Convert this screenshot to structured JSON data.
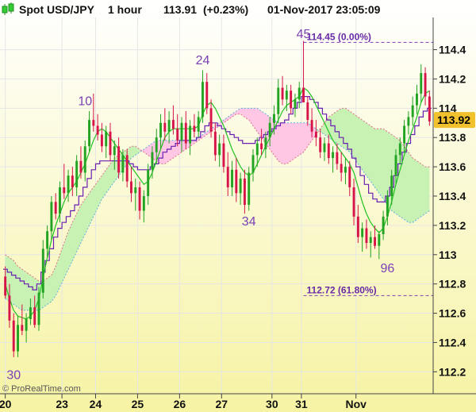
{
  "header": {
    "title": "Spot USD/JPY",
    "timeframe": "1 hour",
    "price": "113.91",
    "change": "(+0.23%)",
    "datetime": "01-Nov-2017 23:05:09"
  },
  "footer": {
    "credit": "© ProRealTime.com"
  },
  "colors": {
    "bull": "#22a322",
    "bear": "#d6144a",
    "kijun": "#6a1fb0",
    "tenkan": "#22c222",
    "cloud_pink": "#ffc7e4",
    "cloud_green": "#c8f2b4",
    "fib": "#7b3fb4",
    "badge": "#f2c12e"
  },
  "chart_data": {
    "type": "candlestick",
    "ylim": [
      112.05,
      114.62
    ],
    "yticks": [
      "114.4",
      "114.2",
      "114",
      "113.8",
      "113.6",
      "113.4",
      "113.2",
      "113",
      "112.8",
      "112.6",
      "112.4",
      "112.2"
    ],
    "xticks": [
      "20",
      "23",
      "24",
      "25",
      "26",
      "27",
      "30",
      "31",
      "Nov"
    ],
    "last_price_badge": "113.92",
    "ohlc": [
      [
        112.85,
        112.92,
        112.7,
        112.72
      ],
      [
        112.72,
        112.8,
        112.5,
        112.55
      ],
      [
        112.55,
        112.6,
        112.3,
        112.34
      ],
      [
        112.34,
        112.58,
        112.3,
        112.52
      ],
      [
        112.52,
        112.66,
        112.45,
        112.48
      ],
      [
        112.48,
        112.6,
        112.4,
        112.56
      ],
      [
        112.56,
        112.7,
        112.52,
        112.64
      ],
      [
        112.64,
        112.72,
        112.5,
        112.52
      ],
      [
        112.52,
        112.78,
        112.48,
        112.74
      ],
      [
        112.74,
        113.1,
        112.7,
        113.04
      ],
      [
        113.04,
        113.2,
        112.98,
        113.16
      ],
      [
        113.16,
        113.4,
        113.1,
        113.36
      ],
      [
        113.36,
        113.42,
        113.24,
        113.28
      ],
      [
        113.28,
        113.5,
        113.22,
        113.46
      ],
      [
        113.46,
        113.62,
        113.38,
        113.42
      ],
      [
        113.42,
        113.58,
        113.36,
        113.54
      ],
      [
        113.54,
        113.6,
        113.4,
        113.46
      ],
      [
        113.46,
        113.68,
        113.4,
        113.64
      ],
      [
        113.64,
        113.74,
        113.52,
        113.56
      ],
      [
        113.56,
        113.78,
        113.5,
        113.74
      ],
      [
        113.74,
        113.98,
        113.7,
        113.92
      ],
      [
        113.92,
        114.1,
        113.84,
        113.88
      ],
      [
        113.88,
        113.96,
        113.78,
        113.82
      ],
      [
        113.82,
        113.9,
        113.7,
        113.74
      ],
      [
        113.74,
        113.88,
        113.66,
        113.84
      ],
      [
        113.84,
        113.9,
        113.64,
        113.68
      ],
      [
        113.68,
        113.78,
        113.58,
        113.74
      ],
      [
        113.74,
        113.8,
        113.52,
        113.56
      ],
      [
        113.56,
        113.72,
        113.5,
        113.68
      ],
      [
        113.68,
        113.72,
        113.46,
        113.5
      ],
      [
        113.5,
        113.6,
        113.36,
        113.42
      ],
      [
        113.42,
        113.52,
        113.3,
        113.46
      ],
      [
        113.46,
        113.5,
        113.24,
        113.3
      ],
      [
        113.3,
        113.44,
        113.22,
        113.4
      ],
      [
        113.4,
        113.62,
        113.34,
        113.58
      ],
      [
        113.58,
        113.74,
        113.52,
        113.7
      ],
      [
        113.7,
        113.86,
        113.62,
        113.8
      ],
      [
        113.8,
        113.96,
        113.72,
        113.9
      ],
      [
        113.9,
        114.0,
        113.78,
        113.84
      ],
      [
        113.84,
        113.98,
        113.76,
        113.92
      ],
      [
        113.92,
        114.02,
        113.82,
        113.86
      ],
      [
        113.86,
        113.96,
        113.74,
        113.78
      ],
      [
        113.78,
        113.94,
        113.7,
        113.9
      ],
      [
        113.9,
        113.98,
        113.72,
        113.76
      ],
      [
        113.76,
        113.92,
        113.68,
        113.88
      ],
      [
        113.88,
        113.96,
        113.8,
        113.84
      ],
      [
        113.84,
        113.98,
        113.8,
        113.94
      ],
      [
        113.94,
        114.26,
        113.9,
        114.18
      ],
      [
        114.18,
        114.24,
        113.96,
        114.0
      ],
      [
        114.0,
        114.06,
        113.8,
        113.84
      ],
      [
        113.84,
        113.9,
        113.64,
        113.68
      ],
      [
        113.68,
        113.82,
        113.6,
        113.76
      ],
      [
        113.76,
        113.82,
        113.56,
        113.6
      ],
      [
        113.6,
        113.7,
        113.4,
        113.46
      ],
      [
        113.46,
        113.64,
        113.4,
        113.58
      ],
      [
        113.58,
        113.66,
        113.36,
        113.42
      ],
      [
        113.42,
        113.56,
        113.34,
        113.52
      ],
      [
        113.52,
        113.58,
        113.28,
        113.34
      ],
      [
        113.34,
        113.6,
        113.3,
        113.56
      ],
      [
        113.56,
        113.72,
        113.5,
        113.68
      ],
      [
        113.68,
        113.8,
        113.6,
        113.76
      ],
      [
        113.76,
        113.86,
        113.68,
        113.72
      ],
      [
        113.72,
        113.84,
        113.66,
        113.8
      ],
      [
        113.8,
        113.94,
        113.74,
        113.9
      ],
      [
        113.9,
        114.02,
        113.82,
        113.96
      ],
      [
        113.96,
        114.2,
        113.9,
        114.14
      ],
      [
        114.14,
        114.22,
        114.02,
        114.06
      ],
      [
        114.06,
        114.16,
        113.98,
        114.12
      ],
      [
        114.12,
        114.16,
        113.96,
        114.0
      ],
      [
        114.0,
        114.1,
        113.94,
        114.06
      ],
      [
        114.06,
        114.18,
        114.0,
        114.14
      ],
      [
        114.14,
        114.46,
        114.1,
        114.04
      ],
      [
        114.04,
        114.08,
        113.88,
        113.92
      ],
      [
        113.92,
        114.0,
        113.8,
        113.84
      ],
      [
        113.84,
        113.92,
        113.74,
        113.8
      ],
      [
        113.8,
        113.86,
        113.66,
        113.7
      ],
      [
        113.7,
        113.8,
        113.64,
        113.76
      ],
      [
        113.76,
        113.82,
        113.62,
        113.66
      ],
      [
        113.66,
        113.74,
        113.56,
        113.7
      ],
      [
        113.7,
        113.76,
        113.58,
        113.62
      ],
      [
        113.62,
        113.7,
        113.5,
        113.56
      ],
      [
        113.56,
        113.66,
        113.48,
        113.6
      ],
      [
        113.6,
        113.64,
        113.4,
        113.46
      ],
      [
        113.46,
        113.52,
        113.2,
        113.26
      ],
      [
        113.26,
        113.34,
        113.08,
        113.12
      ],
      [
        113.12,
        113.22,
        113.02,
        113.18
      ],
      [
        113.18,
        113.24,
        113.04,
        113.08
      ],
      [
        113.08,
        113.16,
        112.98,
        113.12
      ],
      [
        113.12,
        113.2,
        113.04,
        113.06
      ],
      [
        113.06,
        113.16,
        112.97,
        113.14
      ],
      [
        113.14,
        113.3,
        113.1,
        113.26
      ],
      [
        113.26,
        113.44,
        113.2,
        113.4
      ],
      [
        113.4,
        113.58,
        113.34,
        113.54
      ],
      [
        113.54,
        113.72,
        113.48,
        113.68
      ],
      [
        113.68,
        113.8,
        113.62,
        113.76
      ],
      [
        113.76,
        113.92,
        113.7,
        113.88
      ],
      [
        113.88,
        113.98,
        113.82,
        113.94
      ],
      [
        113.94,
        114.08,
        113.88,
        114.02
      ],
      [
        114.02,
        114.16,
        113.96,
        114.1
      ],
      [
        114.1,
        114.3,
        114.04,
        114.24
      ],
      [
        114.24,
        114.28,
        114.02,
        114.08
      ],
      [
        114.08,
        114.12,
        113.88,
        113.91
      ]
    ],
    "tenkan": [
      112.8,
      112.7,
      112.62,
      112.58,
      112.57,
      112.56,
      112.58,
      112.62,
      112.7,
      112.84,
      112.98,
      113.1,
      113.2,
      113.28,
      113.36,
      113.42,
      113.46,
      113.5,
      113.56,
      113.62,
      113.7,
      113.78,
      113.84,
      113.86,
      113.84,
      113.8,
      113.76,
      113.72,
      113.68,
      113.64,
      113.6,
      113.56,
      113.52,
      113.48,
      113.5,
      113.56,
      113.64,
      113.72,
      113.8,
      113.84,
      113.86,
      113.86,
      113.86,
      113.86,
      113.86,
      113.86,
      113.88,
      113.96,
      114.02,
      114.04,
      114.0,
      113.94,
      113.88,
      113.8,
      113.72,
      113.66,
      113.6,
      113.56,
      113.54,
      113.56,
      113.62,
      113.68,
      113.74,
      113.8,
      113.86,
      113.92,
      113.98,
      114.02,
      114.04,
      114.06,
      114.08,
      114.14,
      114.12,
      114.08,
      114.02,
      113.96,
      113.9,
      113.84,
      113.78,
      113.74,
      113.7,
      113.66,
      113.62,
      113.56,
      113.46,
      113.36,
      113.28,
      113.22,
      113.18,
      113.15,
      113.18,
      113.26,
      113.36,
      113.48,
      113.58,
      113.68,
      113.78,
      113.86,
      113.94,
      114.04,
      114.1,
      114.12
    ],
    "kijun": [
      112.9,
      112.88,
      112.86,
      112.84,
      112.82,
      112.8,
      112.78,
      112.76,
      112.8,
      112.88,
      112.96,
      113.04,
      113.12,
      113.18,
      113.22,
      113.26,
      113.3,
      113.34,
      113.4,
      113.46,
      113.52,
      113.58,
      113.62,
      113.64,
      113.64,
      113.64,
      113.64,
      113.64,
      113.64,
      113.64,
      113.62,
      113.6,
      113.58,
      113.58,
      113.58,
      113.6,
      113.62,
      113.66,
      113.7,
      113.72,
      113.74,
      113.76,
      113.78,
      113.78,
      113.78,
      113.78,
      113.8,
      113.84,
      113.88,
      113.9,
      113.9,
      113.88,
      113.86,
      113.84,
      113.82,
      113.8,
      113.78,
      113.76,
      113.76,
      113.76,
      113.78,
      113.8,
      113.82,
      113.84,
      113.86,
      113.88,
      113.9,
      113.92,
      113.96,
      114.0,
      114.04,
      114.08,
      114.08,
      114.06,
      114.04,
      114.0,
      113.96,
      113.92,
      113.88,
      113.84,
      113.8,
      113.76,
      113.72,
      113.66,
      113.6,
      113.54,
      113.48,
      113.42,
      113.38,
      113.36,
      113.36,
      113.4,
      113.46,
      113.54,
      113.62,
      113.7,
      113.76,
      113.82,
      113.88,
      113.94,
      113.98,
      114.0
    ],
    "span_a": [
      113.0,
      112.98,
      112.96,
      112.92,
      112.9,
      112.88,
      112.86,
      112.84,
      112.82,
      112.82,
      112.84,
      112.86,
      112.92,
      113.0,
      113.08,
      113.16,
      113.22,
      113.28,
      113.34,
      113.38,
      113.42,
      113.46,
      113.5,
      113.54,
      113.58,
      113.62,
      113.66,
      113.68,
      113.7,
      113.72,
      113.74,
      113.74,
      113.72,
      113.7,
      113.68,
      113.66,
      113.64,
      113.62,
      113.62,
      113.64,
      113.66,
      113.68,
      113.7,
      113.72,
      113.74,
      113.76,
      113.78,
      113.8,
      113.82,
      113.84,
      113.86,
      113.88,
      113.9,
      113.92,
      113.94,
      113.96,
      113.96,
      113.94,
      113.92,
      113.88,
      113.84,
      113.8,
      113.76,
      113.72,
      113.68,
      113.64,
      113.62,
      113.62,
      113.64,
      113.66,
      113.68,
      113.7,
      113.74,
      113.78,
      113.82,
      113.86,
      113.9,
      113.94,
      113.96,
      113.98,
      114.0,
      114.0,
      113.98,
      113.96,
      113.94,
      113.92,
      113.9,
      113.88,
      113.86,
      113.86,
      113.86,
      113.84,
      113.82,
      113.8,
      113.78,
      113.74,
      113.7,
      113.66,
      113.64,
      113.62,
      113.6,
      113.6
    ],
    "span_b": [
      112.7,
      112.68,
      112.66,
      112.64,
      112.62,
      112.62,
      112.62,
      112.62,
      112.62,
      112.64,
      112.66,
      112.68,
      112.72,
      112.78,
      112.84,
      112.9,
      112.96,
      113.02,
      113.08,
      113.14,
      113.2,
      113.26,
      113.32,
      113.38,
      113.42,
      113.46,
      113.5,
      113.54,
      113.58,
      113.62,
      113.66,
      113.68,
      113.7,
      113.72,
      113.74,
      113.76,
      113.78,
      113.78,
      113.78,
      113.78,
      113.78,
      113.78,
      113.78,
      113.78,
      113.78,
      113.78,
      113.8,
      113.82,
      113.84,
      113.86,
      113.88,
      113.9,
      113.92,
      113.94,
      113.96,
      113.98,
      114.0,
      114.0,
      114.0,
      114.0,
      114.0,
      113.98,
      113.96,
      113.94,
      113.92,
      113.9,
      113.9,
      113.9,
      113.9,
      113.9,
      113.9,
      113.9,
      113.9,
      113.88,
      113.86,
      113.84,
      113.82,
      113.8,
      113.78,
      113.76,
      113.74,
      113.72,
      113.7,
      113.66,
      113.62,
      113.58,
      113.54,
      113.5,
      113.46,
      113.42,
      113.38,
      113.34,
      113.3,
      113.28,
      113.26,
      113.24,
      113.22,
      113.22,
      113.24,
      113.26,
      113.28,
      113.3
    ],
    "wave_labels": [
      {
        "text": "30",
        "bar": 2,
        "price": 112.15
      },
      {
        "text": "10",
        "bar": 19,
        "price": 114.02
      },
      {
        "text": "24",
        "bar": 47,
        "price": 114.3
      },
      {
        "text": "34",
        "bar": 58,
        "price": 113.2
      },
      {
        "text": "45",
        "bar": 71,
        "price": 114.48
      },
      {
        "text": "96",
        "bar": 91,
        "price": 112.88
      }
    ],
    "fib_levels": [
      {
        "price": 114.45,
        "label": "114.45 (0.00%)"
      },
      {
        "price": 112.72,
        "label": "112.72 (61.80%)"
      }
    ]
  }
}
